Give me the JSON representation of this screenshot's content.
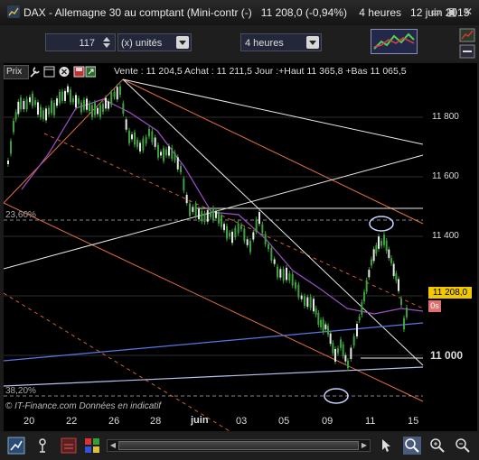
{
  "window": {
    "title": "DAX - Allemagne 30 au comptant (Mini-contr (-)",
    "last": "11 208,0 (-0,94%)",
    "timeframe": "4 heures",
    "date": "12 juin 2015"
  },
  "toolbar": {
    "quantity": "117",
    "units": "(x) unités",
    "period": "4 heures"
  },
  "info": {
    "prix_tab": "Prix",
    "quote": "Vente : 11 204,5 Achat : 11 211,5 Jour :+Haut 11 365,8 +Bas 11 065,5"
  },
  "chart": {
    "y_ticks": [
      "11 800",
      "11 600",
      "11 400",
      "11 000"
    ],
    "x_ticks": [
      "20",
      "22",
      "26",
      "28",
      "juin",
      "03",
      "05",
      "09",
      "11",
      "15"
    ],
    "fib_top": "23,60%",
    "fib_bottom": "38,20%",
    "copyright": "© IT-Finance.com  Données en indicatif",
    "price_badge": "11 208,0",
    "countdown": "0s"
  },
  "colors": {
    "price_badge": "#f0c800",
    "countdown_badge": "#e07070",
    "candle": "#3ca03c",
    "ma": "#a050c8",
    "channel": "#e07040",
    "blue_line": "#5a78e6"
  }
}
